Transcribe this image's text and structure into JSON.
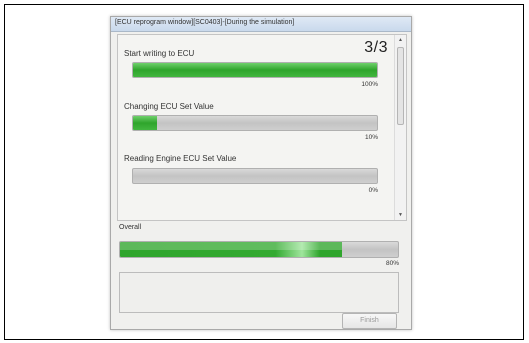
{
  "window": {
    "title": "[ECU reprogram window][SC0403]-[During the simulation]"
  },
  "steps_panel": {
    "page_counter": "3/3",
    "steps": [
      {
        "label": "Start writing to ECU",
        "progress": 100,
        "percent_text": "100%"
      },
      {
        "label": "Changing ECU Set Value",
        "progress": 10,
        "percent_text": "10%"
      },
      {
        "label": "Reading Engine ECU Set Value",
        "progress": 0,
        "percent_text": "0%"
      }
    ]
  },
  "overall": {
    "label": "Overall",
    "progress": 80,
    "percent_text": "80%"
  },
  "buttons": {
    "finish_label": "Finish"
  },
  "icons": {
    "scroll_up": "scroll-up-arrow-icon",
    "scroll_down": "scroll-down-arrow-icon"
  },
  "colors": {
    "progress_green": "#2fa52c",
    "progress_track": "#c8c8c8"
  }
}
